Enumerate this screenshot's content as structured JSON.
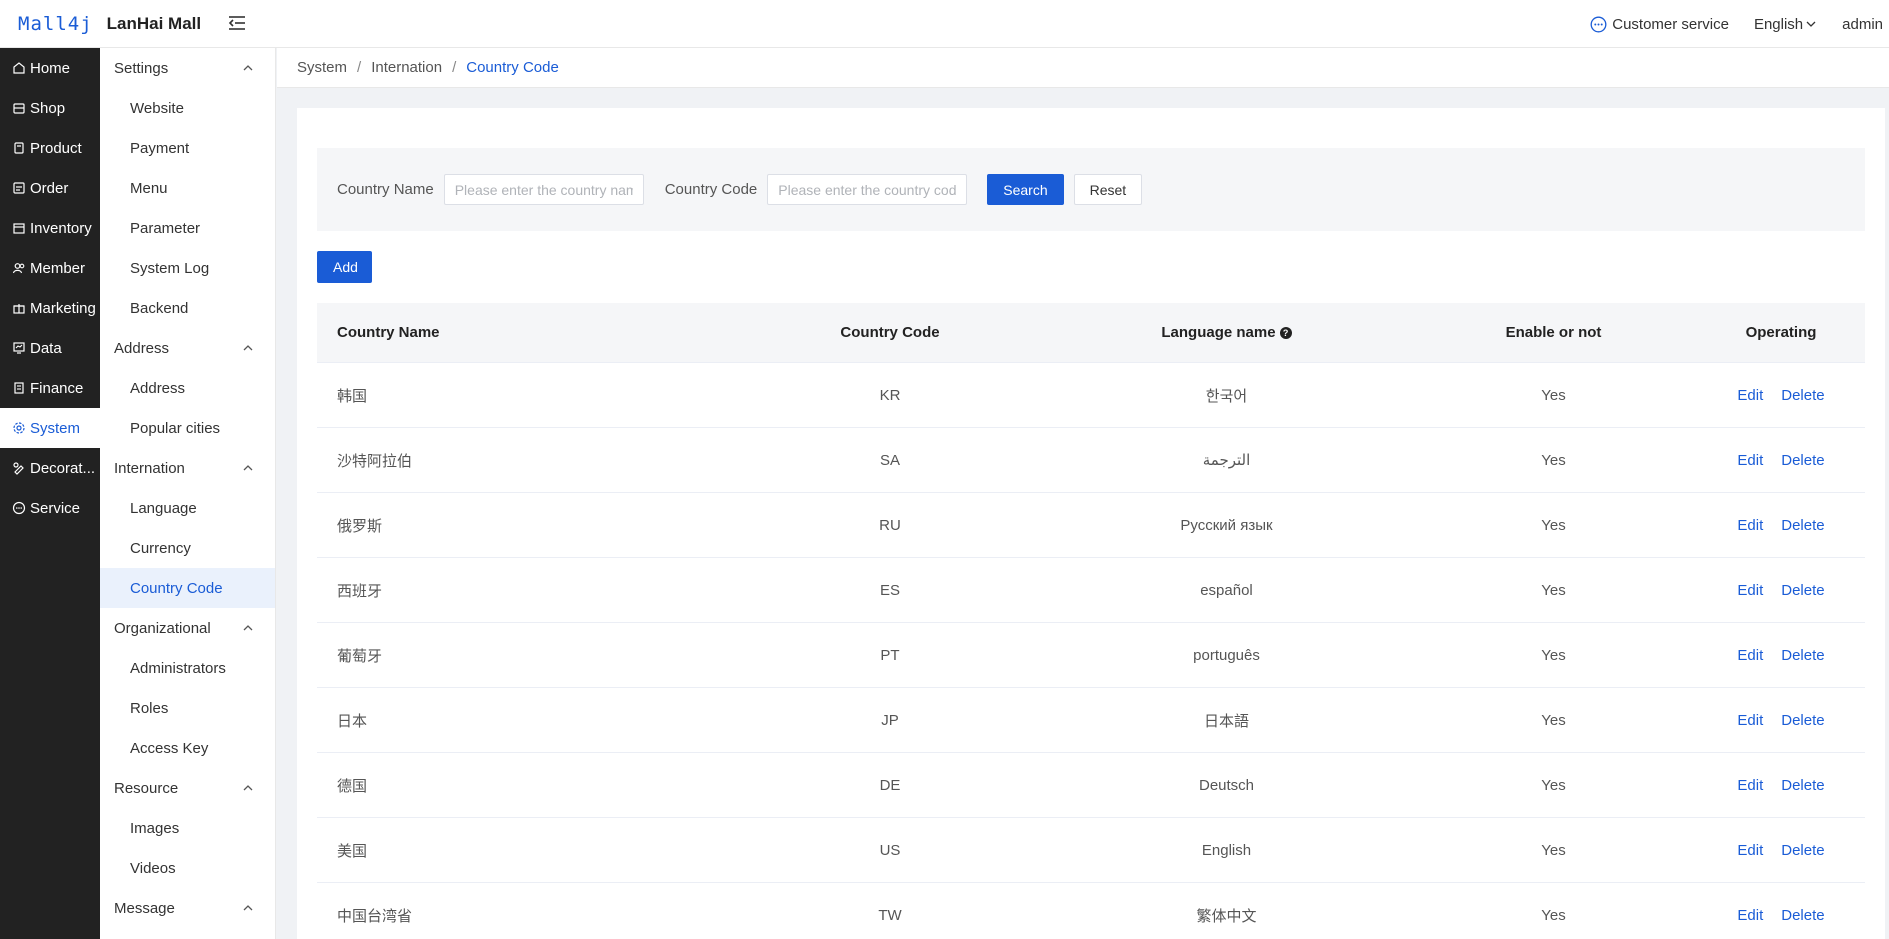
{
  "header": {
    "logo_text": "Mall4j",
    "app_name": "LanHai Mall",
    "customer_service": "Customer service",
    "language": "English",
    "user": "admin"
  },
  "nav1": {
    "items": [
      {
        "label": "Home",
        "icon": "home-icon"
      },
      {
        "label": "Shop",
        "icon": "shop-icon"
      },
      {
        "label": "Product",
        "icon": "product-icon"
      },
      {
        "label": "Order",
        "icon": "order-icon"
      },
      {
        "label": "Inventory",
        "icon": "inventory-icon"
      },
      {
        "label": "Member",
        "icon": "member-icon"
      },
      {
        "label": "Marketing",
        "icon": "marketing-icon"
      },
      {
        "label": "Data",
        "icon": "data-icon"
      },
      {
        "label": "Finance",
        "icon": "finance-icon"
      },
      {
        "label": "System",
        "icon": "gear-icon",
        "active": true
      },
      {
        "label": "Decorat...",
        "icon": "decorate-icon"
      },
      {
        "label": "Service",
        "icon": "chat-icon"
      }
    ]
  },
  "nav2": {
    "groups": [
      {
        "label": "Settings",
        "items": [
          "Website",
          "Payment",
          "Menu",
          "Parameter",
          "System Log",
          "Backend"
        ]
      },
      {
        "label": "Address",
        "items": [
          "Address",
          "Popular cities"
        ]
      },
      {
        "label": "Internation",
        "items": [
          "Language",
          "Currency",
          "Country Code"
        ]
      },
      {
        "label": "Organizational",
        "items": [
          "Administrators",
          "Roles",
          "Access Key"
        ]
      },
      {
        "label": "Resource",
        "items": [
          "Images",
          "Videos"
        ]
      },
      {
        "label": "Message",
        "items": []
      }
    ],
    "active_item": "Country Code"
  },
  "breadcrumb": {
    "items": [
      "System",
      "Internation"
    ],
    "current": "Country Code"
  },
  "search": {
    "country_name_label": "Country Name",
    "country_name_placeholder": "Please enter the country name",
    "country_code_label": "Country Code",
    "country_code_placeholder": "Please enter the country code",
    "search_button": "Search",
    "reset_button": "Reset"
  },
  "add_button": "Add",
  "table": {
    "headers": {
      "country_name": "Country Name",
      "country_code": "Country Code",
      "language_name": "Language name",
      "enable": "Enable or not",
      "operating": "Operating"
    },
    "edit_label": "Edit",
    "delete_label": "Delete",
    "rows": [
      {
        "name": "韩国",
        "code": "KR",
        "language": "한국어",
        "enabled": "Yes"
      },
      {
        "name": "沙特阿拉伯",
        "code": "SA",
        "language": "الترجمة",
        "enabled": "Yes"
      },
      {
        "name": "俄罗斯",
        "code": "RU",
        "language": "Русский язык",
        "enabled": "Yes"
      },
      {
        "name": "西班牙",
        "code": "ES",
        "language": "español",
        "enabled": "Yes"
      },
      {
        "name": "葡萄牙",
        "code": "PT",
        "language": "português",
        "enabled": "Yes"
      },
      {
        "name": "日本",
        "code": "JP",
        "language": "日本語",
        "enabled": "Yes"
      },
      {
        "name": "德国",
        "code": "DE",
        "language": "Deutsch",
        "enabled": "Yes"
      },
      {
        "name": "美国",
        "code": "US",
        "language": "English",
        "enabled": "Yes"
      },
      {
        "name": "中国台湾省",
        "code": "TW",
        "language": "繁体中文",
        "enabled": "Yes"
      }
    ]
  }
}
